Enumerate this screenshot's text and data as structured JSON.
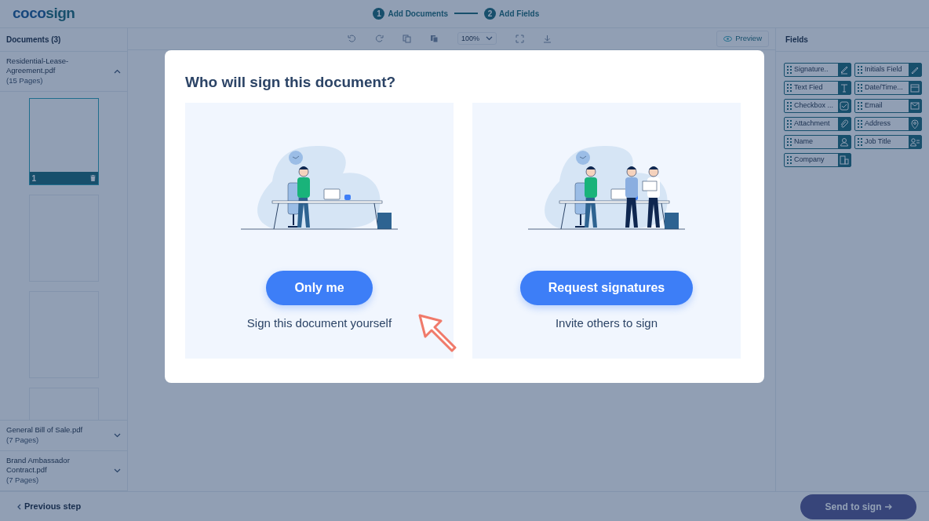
{
  "app": {
    "logo": {
      "first": "coco",
      "second": "sign"
    },
    "steps": [
      {
        "number": "1",
        "label": "Add Documents"
      },
      {
        "number": "2",
        "label": "Add Fields"
      }
    ],
    "documents": {
      "title": "Documents (3)",
      "items": [
        {
          "name": "Residential-Lease-Agreement.pdf",
          "pages": "(15 Pages)",
          "expanded": true,
          "thumbnails": [
            {
              "label": "1",
              "selected": true
            },
            {
              "selected": false
            },
            {
              "selected": false
            },
            {
              "selected": false
            }
          ]
        },
        {
          "name": "General Bill of Sale.pdf",
          "pages": "(7 Pages)",
          "expanded": false
        },
        {
          "name": "Brand Ambassador Contract.pdf",
          "pages": "(7 Pages)",
          "expanded": false
        }
      ]
    },
    "toolbar": {
      "zoom": "100%",
      "preview": "Preview"
    },
    "fields": {
      "title": "Fields",
      "items": [
        {
          "label": "Signature..",
          "kind": "signature"
        },
        {
          "label": "Initials Field",
          "kind": "initials"
        },
        {
          "label": "Text Fied",
          "kind": "text"
        },
        {
          "label": "Date/Time...",
          "kind": "date"
        },
        {
          "label": "Checkbox ...",
          "kind": "checkbox"
        },
        {
          "label": "Email",
          "kind": "email"
        },
        {
          "label": "Attachment",
          "kind": "attachment"
        },
        {
          "label": "Address",
          "kind": "address"
        },
        {
          "label": "Name",
          "kind": "person"
        },
        {
          "label": "Job Title",
          "kind": "job"
        },
        {
          "label": "Company",
          "kind": "company"
        }
      ]
    },
    "footer": {
      "previous": "Previous step",
      "send": "Send to sign"
    }
  },
  "dialog": {
    "title": "Who will sign this document?",
    "options": [
      {
        "button": "Only me",
        "caption": "Sign this document yourself",
        "kind": "single",
        "pointed": true
      },
      {
        "button": "Request signatures",
        "caption": "Invite others to sign",
        "kind": "group",
        "pointed": false
      }
    ]
  }
}
